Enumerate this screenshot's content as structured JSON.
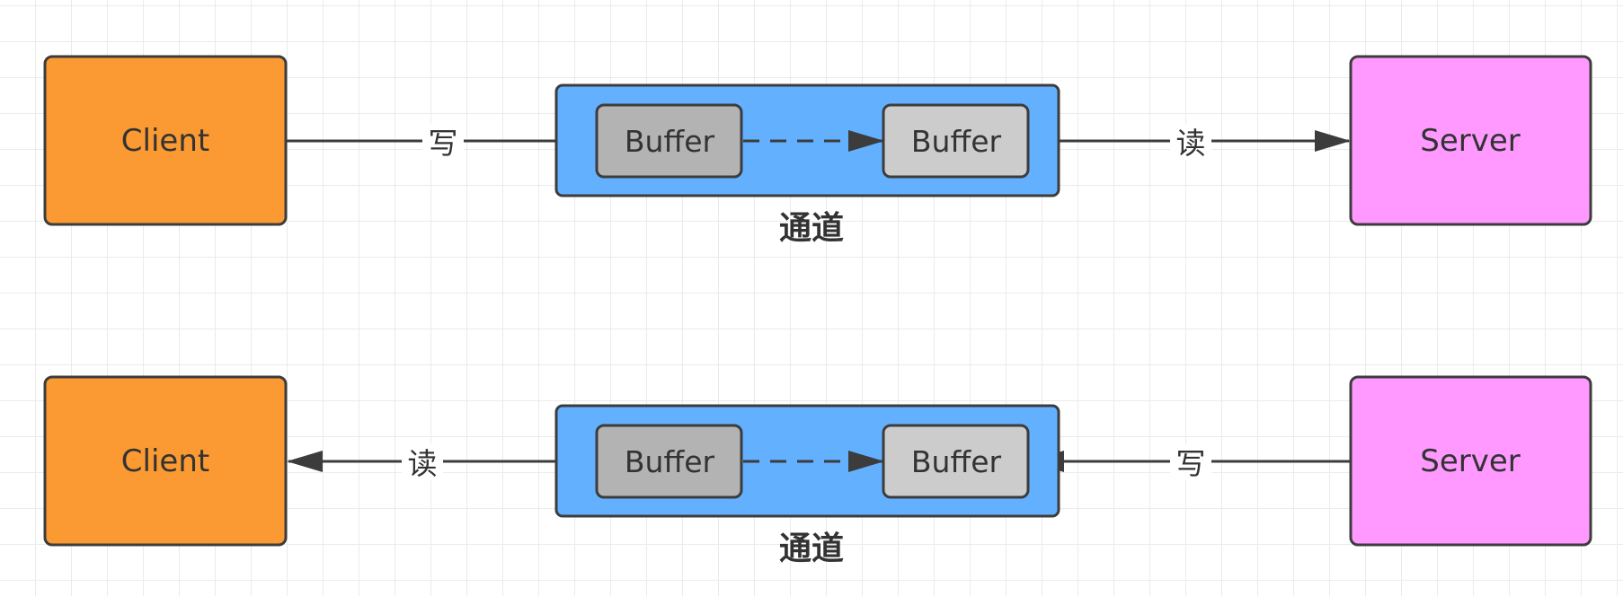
{
  "colors": {
    "client_fill": "#fb9a32",
    "server_fill": "#ff99ff",
    "channel_fill": "#63b0ff",
    "buffer_dark_fill": "#b3b3b3",
    "buffer_light_fill": "#cccccc",
    "stroke": "#3c3c3c"
  },
  "rows": [
    {
      "client_label": "Client",
      "server_label": "Server",
      "buffer_left_label": "Buffer",
      "buffer_right_label": "Buffer",
      "left_edge_label": "写",
      "right_edge_label": "读",
      "channel_label": "通道",
      "flow": "client-to-server"
    },
    {
      "client_label": "Client",
      "server_label": "Server",
      "buffer_left_label": "Buffer",
      "buffer_right_label": "Buffer",
      "left_edge_label": "读",
      "right_edge_label": "写",
      "channel_label": "通道",
      "flow": "server-to-client"
    }
  ]
}
